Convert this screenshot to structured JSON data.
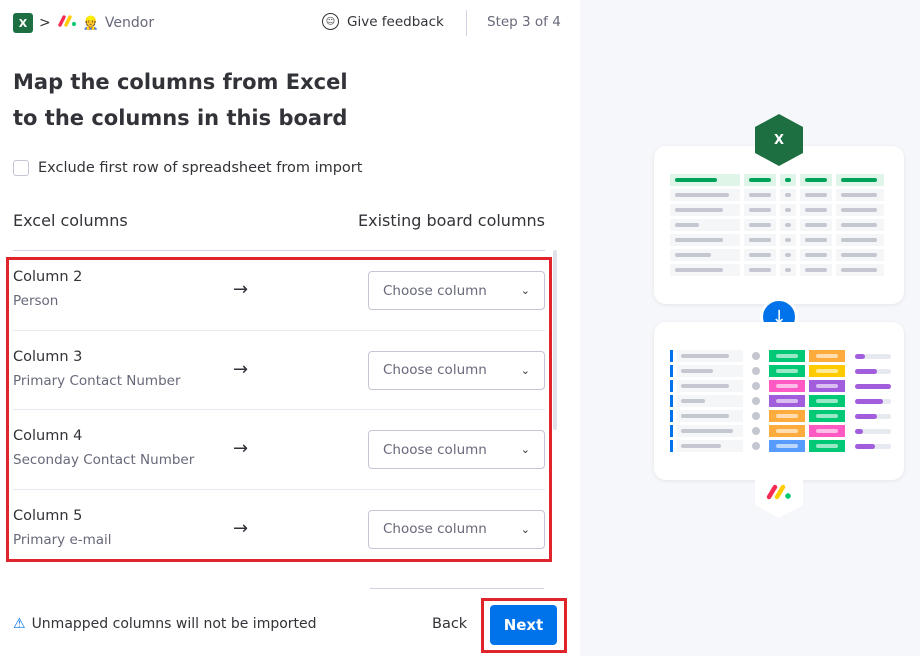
{
  "header": {
    "breadcrumb_sep": ">",
    "board_name": "Vendor",
    "feedback_label": "Give feedback",
    "step_label": "Step 3 of 4"
  },
  "title": "Map the columns from Excel to the columns in this board",
  "exclude_label": "Exclude first row of spreadsheet from import",
  "columns_header": {
    "left": "Excel columns",
    "right": "Existing board columns"
  },
  "rows": [
    {
      "name": "Column 2",
      "sub": "Person",
      "select": "Choose column"
    },
    {
      "name": "Column 3",
      "sub": "Primary Contact Number",
      "select": "Choose column"
    },
    {
      "name": "Column 4",
      "sub": "Seconday Contact Number",
      "select": "Choose column"
    },
    {
      "name": "Column 5",
      "sub": "Primary e-mail",
      "select": "Choose column"
    }
  ],
  "footer": {
    "warning": "Unmapped columns will not be imported",
    "back_label": "Back",
    "next_label": "Next"
  },
  "icons": {
    "excel": "excel-icon",
    "monday": "monday-logo",
    "feedback": "feedback-icon",
    "warning": "warning-icon",
    "arrow": "arrow-right-icon",
    "chevron": "chevron-down-icon"
  },
  "colors": {
    "primary": "#0073ea",
    "excel_green": "#1d6f42",
    "highlight": "#e0242b"
  }
}
